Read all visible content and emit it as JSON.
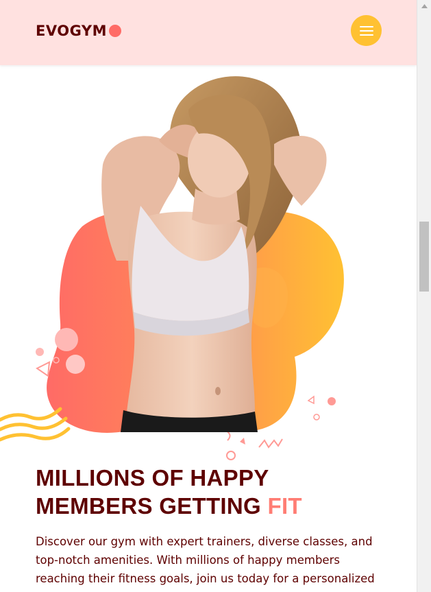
{
  "navbar": {
    "logo_text": "EVOGYM",
    "menu_icon": "hamburger-menu-icon"
  },
  "hero": {
    "image_alt": "woman in sports bra",
    "decoration_icons": [
      "triangle-icon",
      "circle-icon",
      "wave-icon",
      "zigzag-icon"
    ]
  },
  "content": {
    "headline_line1": "MILLIONS OF HAPPY",
    "headline_line2_prefix": "MEMBERS GETTING ",
    "headline_accent": "FIT",
    "intro_text": "Discover our gym with expert trainers, diverse classes, and top-notch amenities. With millions of happy members reaching their fitness goals, join us today for a personalized"
  },
  "colors": {
    "brand_dark": "#5e0000",
    "accent_coral": "#ff6b66",
    "accent_yellow": "#ffc132",
    "header_bg": "#ffe1e0"
  }
}
